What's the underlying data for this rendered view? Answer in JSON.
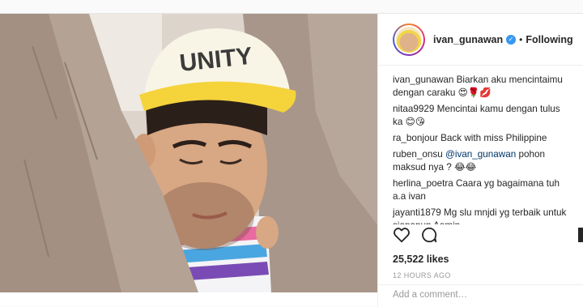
{
  "post": {
    "username": "ivan_gunawan",
    "verified_glyph": "✓",
    "separator": "•",
    "follow_label": "Following",
    "cap_text": "UNITY",
    "caption": {
      "user": "ivan_gunawan",
      "text": " Biarkan aku mencintaimu dengan caraku 😍🌹💋"
    },
    "comments": [
      {
        "user": "nitaa9929",
        "text": " Mencintai kamu dengan tulus ka 😊😘"
      },
      {
        "user": "ra_bonjour",
        "text": " Back with miss Philippine"
      },
      {
        "user": "ruben_onsu",
        "mention": " @ivan_gunawan",
        "text": " pohon maksud nya ? 😂😂"
      },
      {
        "user": "herlina_poetra",
        "text": " Caara yg bagaimana tuh a.a ivan"
      },
      {
        "user": "jayanti1879",
        "text": " Mg slu mnjdi yg terbaik untuk siapapun Aamin"
      }
    ],
    "likes": "25,522 likes",
    "time": "12 HOURS AGO",
    "add_comment_placeholder": "Add a comment…"
  },
  "icons": {
    "like": "heart-icon",
    "comment": "comment-icon",
    "save": "bookmark-icon"
  },
  "colors": {
    "verified": "#3897f0",
    "mention": "#003569",
    "cap_yellow": "#f5d33b"
  }
}
